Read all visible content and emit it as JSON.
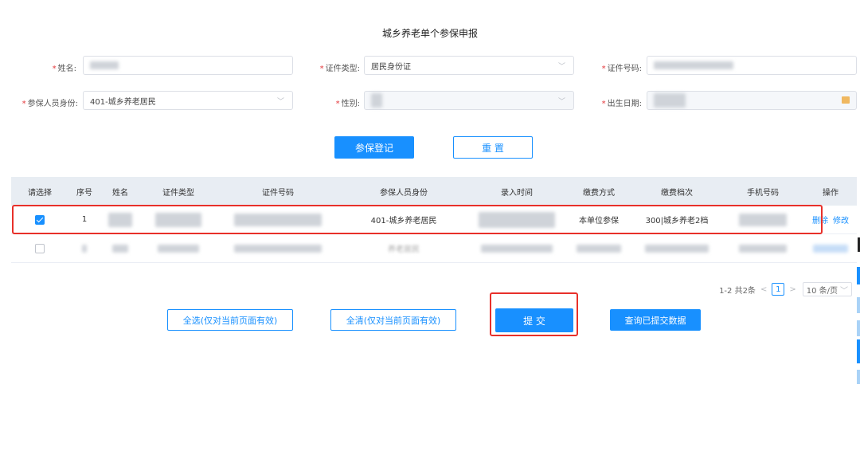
{
  "title": "城乡养老单个参保申报",
  "form": {
    "name_label": "姓名:",
    "id_type_label": "证件类型:",
    "id_type_value": "居民身份证",
    "id_no_label": "证件号码:",
    "insured_identity_label": "参保人员身份:",
    "insured_identity_value": "401-城乡养老居民",
    "gender_label": "性别:",
    "birth_date_label": "出生日期:"
  },
  "buttons": {
    "register": "参保登记",
    "reset": "重 置",
    "select_all": "全选(仅对当前页面有效)",
    "clear_all": "全清(仅对当前页面有效)",
    "submit": "提 交",
    "query_submitted": "查询已提交数据"
  },
  "table": {
    "headers": [
      "请选择",
      "序号",
      "姓名",
      "证件类型",
      "证件号码",
      "参保人员身份",
      "录入时间",
      "缴费方式",
      "缴费档次",
      "手机号码",
      "操作"
    ],
    "row1": {
      "index": "1",
      "identity": "401-城乡养老居民",
      "pay_method": "本单位参保",
      "pay_grade": "300|城乡养老2档",
      "delete": "删除",
      "edit": "修改"
    },
    "row2": {
      "identity_partial": "养老居民"
    }
  },
  "pagination": {
    "summary": "1-2 共2条",
    "current_page": "1",
    "page_size": "10 条/页"
  },
  "colors": {
    "primary": "#1890ff",
    "highlight": "#e8302a",
    "header_bg": "#e8edf3"
  }
}
